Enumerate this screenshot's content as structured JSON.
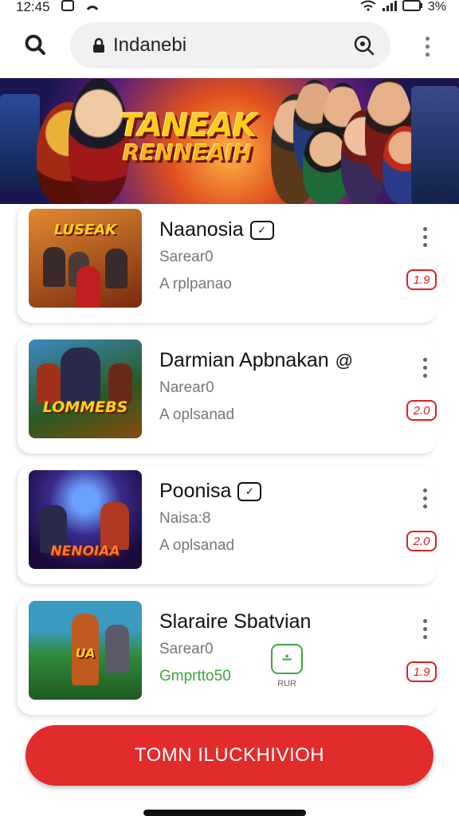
{
  "status_bar": {
    "time": "12:45",
    "battery": "3%"
  },
  "browser": {
    "url_text": "Indanebi"
  },
  "banner": {
    "title_line1": "TANEAK",
    "title_line2": "RENNEAIH"
  },
  "apps": [
    {
      "title": "Naanosia",
      "subtitle": "Sarear0",
      "description": "A rplpanao",
      "rating": "1.9",
      "thumb_label": "LUSEAK",
      "thumb_bg": "#c46a20"
    },
    {
      "title": "Darmian Apbnakan",
      "subtitle": "Narear0",
      "description": "A oplsanad",
      "rating": "2.0",
      "thumb_label": "LOMMEBS",
      "thumb_bg": "#4a7a2a"
    },
    {
      "title": "Poonisa",
      "subtitle": "Naisa:8",
      "description": "A oplsanad",
      "rating": "2.0",
      "thumb_label": "NENOIAA",
      "thumb_bg": "#3a2a7a"
    },
    {
      "title": "Slaraire Sbatvian",
      "subtitle": "Sarear0",
      "description": "Gmprtto50",
      "rating": "1.9",
      "thumb_label": "UA",
      "thumb_bg": "#2f8a3a",
      "install_label": "RUR"
    }
  ],
  "cta": {
    "label": "TOMN ILUCKHIVIOH"
  },
  "colors": {
    "accent_red": "#e22b2b",
    "install_green": "#3ca83c"
  }
}
